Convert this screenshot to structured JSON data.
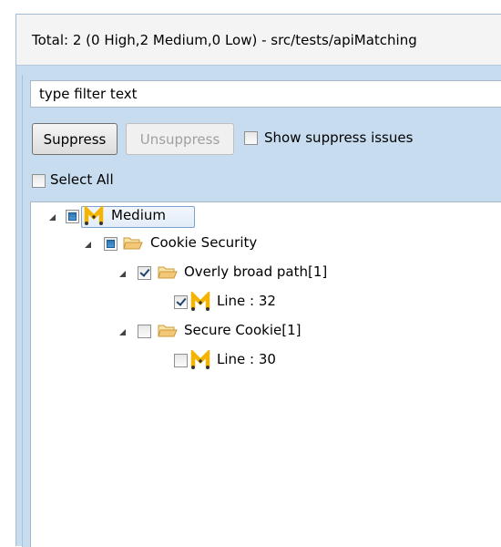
{
  "summary": {
    "text": "Total: 2 (0 High,2 Medium,0 Low) - src/tests/apiMatching"
  },
  "filter": {
    "value": "type filter text"
  },
  "toolbar": {
    "suppress_label": "Suppress",
    "unsuppress_label": "Unsuppress",
    "show_suppressed_label": "Show suppress issues",
    "show_suppressed_checked": false,
    "select_all_label": "Select All",
    "select_all_checked": false
  },
  "tree": {
    "severity": {
      "label": "Medium",
      "icon": "medium-severity-icon",
      "state": "partial",
      "expanded": true,
      "selected": true
    },
    "category": {
      "label": "Cookie Security",
      "icon": "folder-icon",
      "state": "partial",
      "expanded": true
    },
    "issues": [
      {
        "label": "Overly broad path[1]",
        "icon": "folder-icon",
        "state": "checked",
        "expanded": true,
        "children": [
          {
            "label": "Line : 32",
            "icon": "medium-severity-icon",
            "state": "checked"
          }
        ]
      },
      {
        "label": "Secure Cookie[1]",
        "icon": "folder-icon",
        "state": "unchecked",
        "expanded": true,
        "children": [
          {
            "label": "Line : 30",
            "icon": "medium-severity-icon",
            "state": "unchecked"
          }
        ]
      }
    ]
  },
  "colors": {
    "panel_background": "#c7dcef",
    "severity_icon": "#f5b400",
    "folder_icon": "#f3c776"
  }
}
